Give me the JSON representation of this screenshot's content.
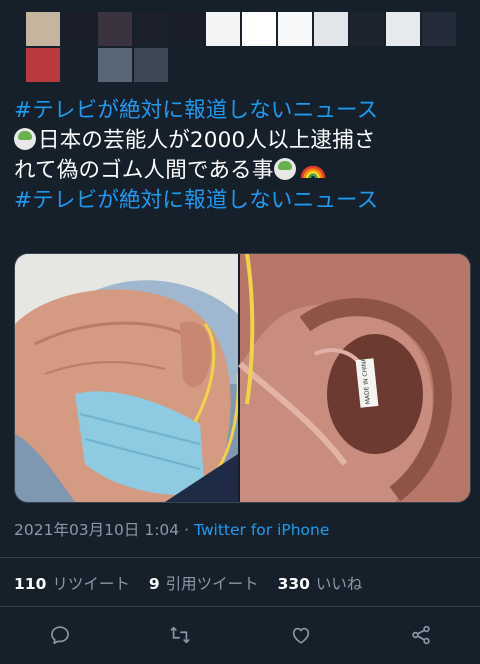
{
  "tweet": {
    "lines": [
      {
        "hashtag": "#テレビが絶対に報道しないニュース"
      },
      {
        "emoji_before": "tea-bowl-emoji",
        "text": "日本の芸能人が2000人以上逮捕さ"
      },
      {
        "text": "れて偽のゴム人間である事",
        "emoji_after": [
          "tea-bowl-emoji",
          "rainbow-emoji"
        ]
      },
      {
        "hashtag": "#テレビが絶対に報道しないニュース"
      }
    ]
  },
  "media": {
    "left_caption": "",
    "right_label_text": "MADE IN CHINA"
  },
  "meta": {
    "date": "2021年03月10日",
    "time": "1:04",
    "separator": "·",
    "source": "Twitter for iPhone"
  },
  "stats": {
    "retweets": {
      "count": "110",
      "label": "リツイート"
    },
    "quotes": {
      "count": "9",
      "label": "引用ツイート"
    },
    "likes": {
      "count": "330",
      "label": "いいね"
    }
  },
  "actions": [
    {
      "name": "reply-icon"
    },
    {
      "name": "retweet-icon"
    },
    {
      "name": "like-icon"
    },
    {
      "name": "share-icon"
    }
  ],
  "colors": {
    "background": "#15202b",
    "accent": "#1d9bf0",
    "muted": "#8b98a5",
    "divider": "#38444d"
  }
}
